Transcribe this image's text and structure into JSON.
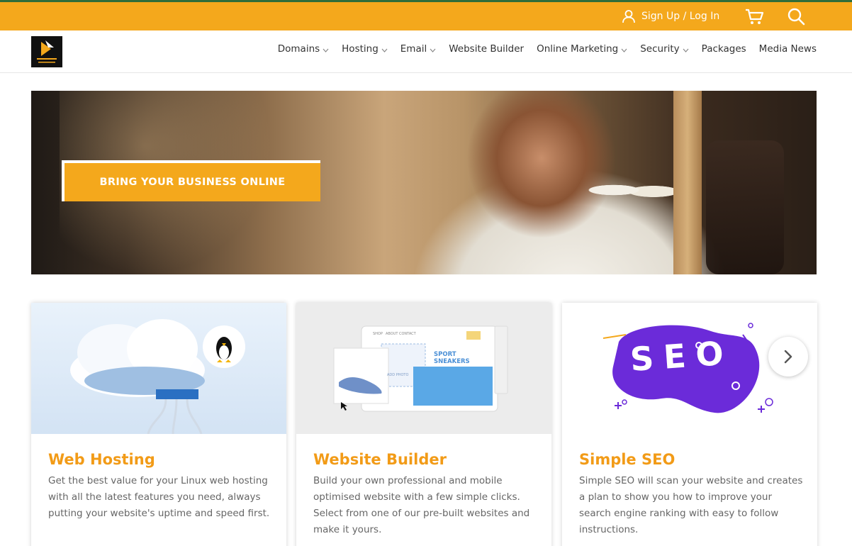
{
  "topbar": {
    "signup_label": "Sign Up / Log In",
    "accent": "#f4a81c"
  },
  "nav": {
    "items": [
      {
        "label": "Domains",
        "dropdown": true
      },
      {
        "label": "Hosting",
        "dropdown": true
      },
      {
        "label": "Email",
        "dropdown": true
      },
      {
        "label": "Website Builder",
        "dropdown": false
      },
      {
        "label": "Online Marketing",
        "dropdown": true
      },
      {
        "label": "Security",
        "dropdown": true
      },
      {
        "label": "Packages",
        "dropdown": false
      },
      {
        "label": "Media News",
        "dropdown": false
      }
    ]
  },
  "hero": {
    "cta_label": "BRING YOUR BUSINESS ONLINE"
  },
  "cards": [
    {
      "title": "Web Hosting",
      "description": "Get the best value for your Linux web hosting with all the latest features you need, always putting your website's uptime and speed first."
    },
    {
      "title": "Website Builder",
      "description": "Build your own professional and mobile optimised website with a few simple clicks. Select from one of our pre-built websites and make it yours.",
      "mockup": {
        "menu": [
          "SHOP",
          "ABOUT",
          "CONTACT"
        ],
        "heading": "SPORT SNEAKERS",
        "photo_label": "ADD PHOTO"
      }
    },
    {
      "title": "Simple SEO",
      "description": "Simple SEO will scan your website and creates a plan to show you how to improve your search engine ranking with easy to follow instructions.",
      "badge_text": "SEO"
    }
  ],
  "colors": {
    "accent_orange": "#f4a81c",
    "title_orange": "#f29b17",
    "seo_purple": "#6b2bd9"
  }
}
